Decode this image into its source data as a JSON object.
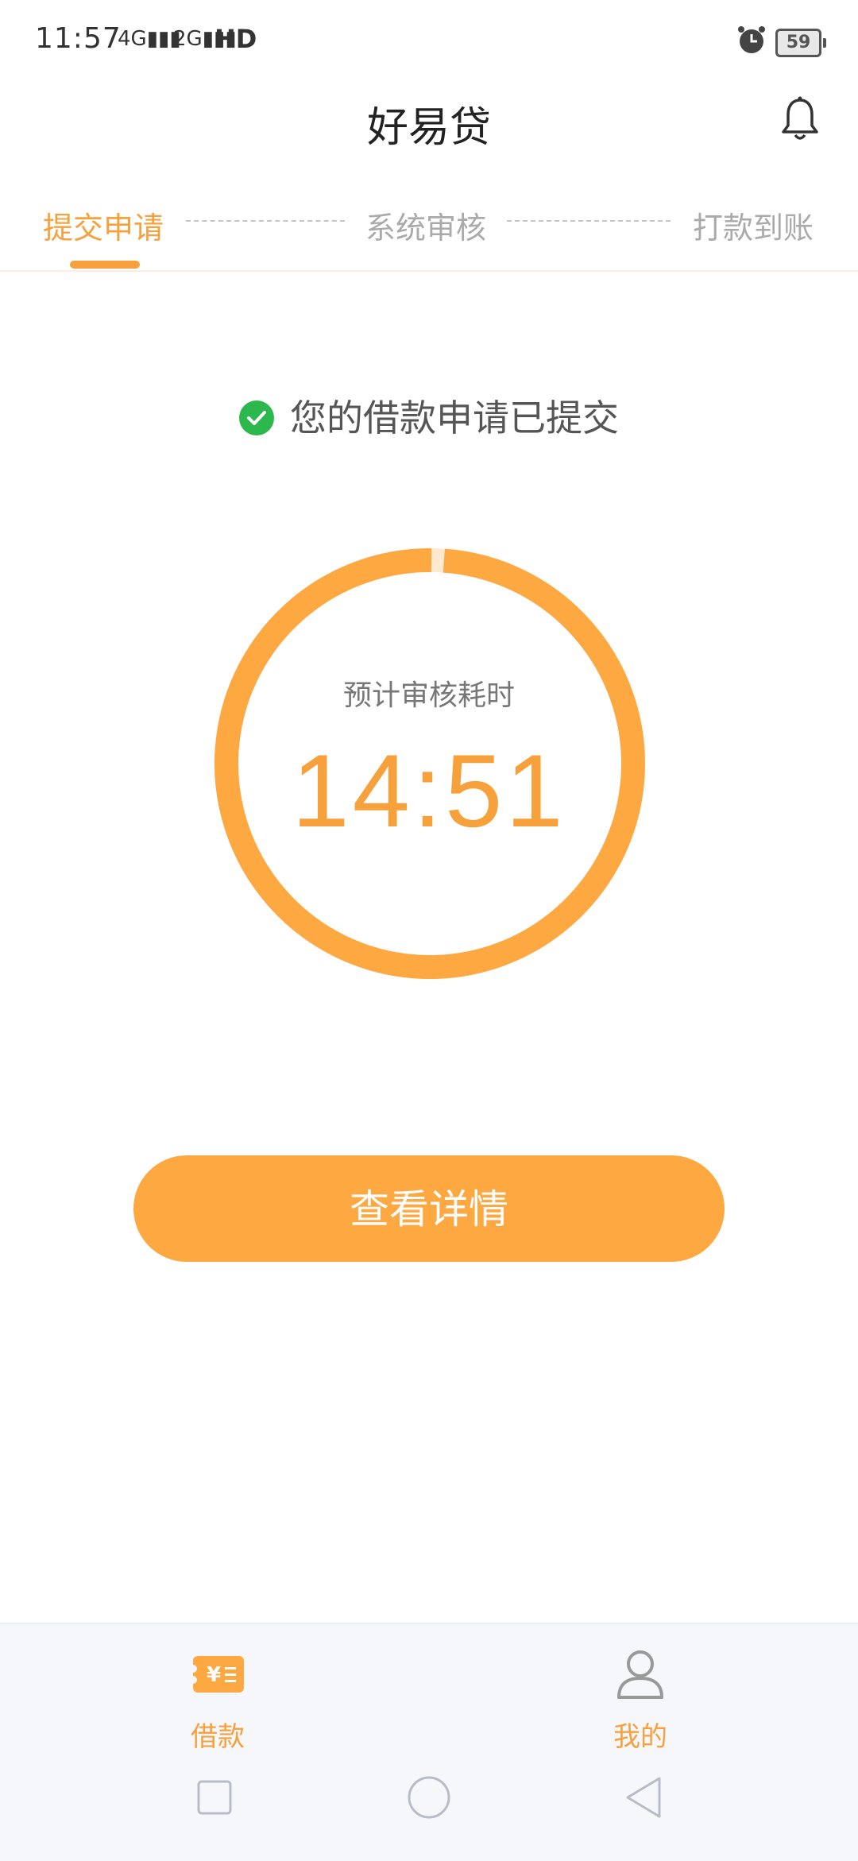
{
  "status_bar": {
    "time": "11:57",
    "network_1": "4G",
    "network_2": "2G",
    "hd": "HD",
    "battery": "59"
  },
  "header": {
    "title": "好易贷",
    "bell_icon": "bell-icon"
  },
  "steps": [
    {
      "label": "提交申请",
      "active": true
    },
    {
      "label": "系统审核",
      "active": false
    },
    {
      "label": "打款到账",
      "active": false
    }
  ],
  "notice": {
    "text": "您的借款申请已提交",
    "icon": "check-circle-icon"
  },
  "timer": {
    "label": "预计审核耗时",
    "time": "14:51",
    "progress": 0.99
  },
  "actions": {
    "detail_button": "查看详情"
  },
  "bottom_nav": {
    "items": [
      {
        "label": "借款",
        "icon": "loan-ticket-icon",
        "active": true
      },
      {
        "label": "我的",
        "icon": "user-icon",
        "active": false
      }
    ]
  },
  "system_nav": {
    "recent": "square-icon",
    "home": "circle-icon",
    "back": "triangle-back-icon"
  },
  "colors": {
    "accent": "#f7a13c",
    "button": "#fea842",
    "success": "#2db84d"
  }
}
